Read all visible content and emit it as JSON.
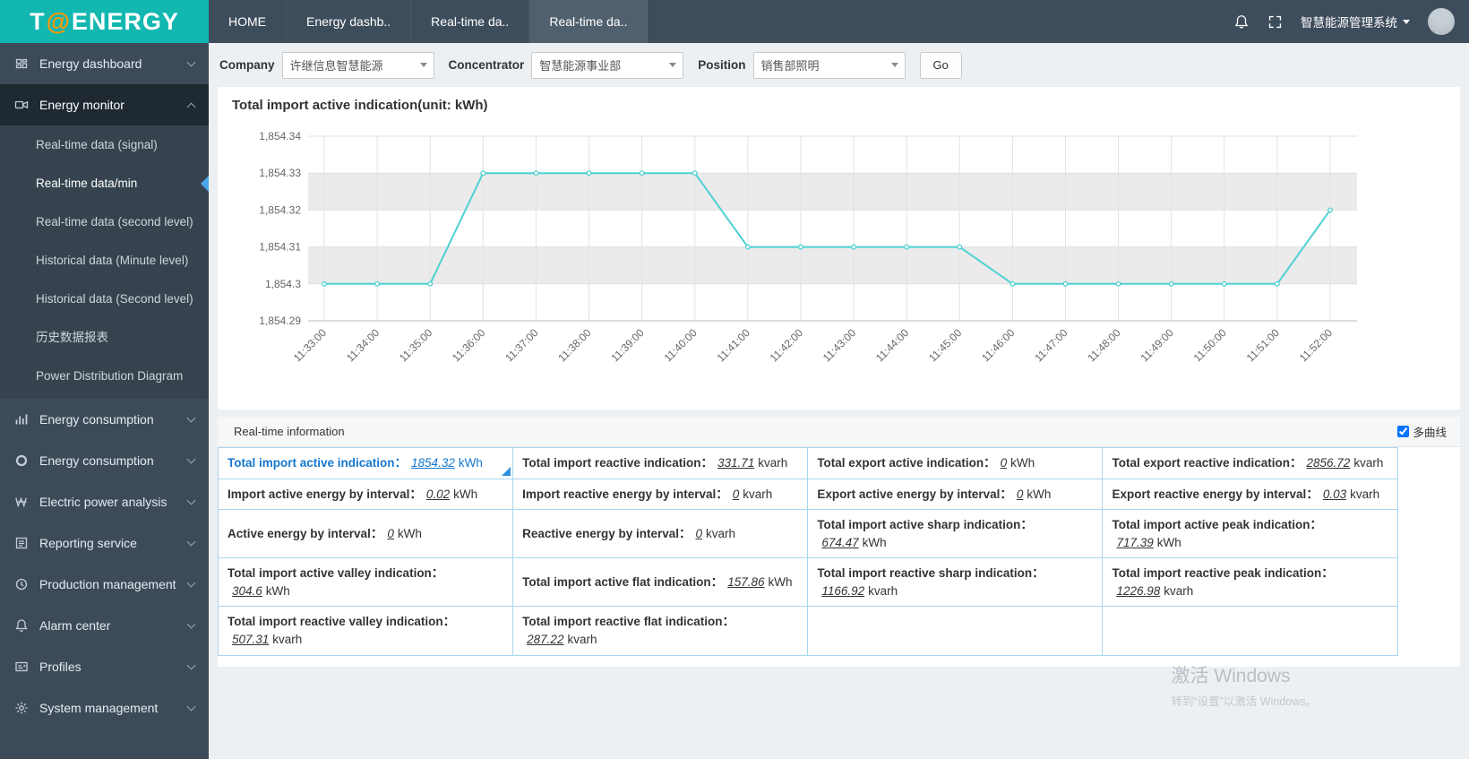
{
  "brand": {
    "part1": "T",
    "part2": "@",
    "part3": "ENERGY"
  },
  "topnav": {
    "tabs": [
      {
        "label": "HOME",
        "active": false
      },
      {
        "label": "Energy dashb..",
        "active": false
      },
      {
        "label": "Real-time da..",
        "active": false
      },
      {
        "label": "Real-time da..",
        "active": true
      }
    ],
    "system_menu": "智慧能源管理系统"
  },
  "sidebar": {
    "items": [
      {
        "label": "Energy dashboard",
        "icon": "dashboard-icon"
      },
      {
        "label": "Energy monitor",
        "icon": "monitor-icon",
        "active": true,
        "expanded": true,
        "children": [
          {
            "label": "Real-time data (signal)"
          },
          {
            "label": "Real-time data/min",
            "active": true
          },
          {
            "label": "Real-time data (second level)"
          },
          {
            "label": "Historical data (Minute level)"
          },
          {
            "label": "Historical data (Second level)"
          },
          {
            "label": "历史数据报表"
          },
          {
            "label": "Power Distribution Diagram"
          }
        ]
      },
      {
        "label": "Energy consumption",
        "icon": "bar-chart-icon"
      },
      {
        "label": "Energy consumption",
        "icon": "donut-icon"
      },
      {
        "label": "Electric power analysis",
        "icon": "power-icon"
      },
      {
        "label": "Reporting service",
        "icon": "report-icon"
      },
      {
        "label": "Production management",
        "icon": "clock-icon"
      },
      {
        "label": "Alarm center",
        "icon": "alarm-bell-icon"
      },
      {
        "label": "Profiles",
        "icon": "profiles-card-icon"
      },
      {
        "label": "System management",
        "icon": "gear-icon"
      }
    ]
  },
  "filters": {
    "company_label": "Company",
    "company_value": "许继信息智慧能源",
    "concentrator_label": "Concentrator",
    "concentrator_value": "智慧能源事业部",
    "position_label": "Position",
    "position_value": "销售部照明",
    "go_label": "Go"
  },
  "chart_data": {
    "type": "line",
    "title": "Total import active indication(unit:  kWh)",
    "x": [
      "11:33:00",
      "11:34:00",
      "11:35:00",
      "11:36:00",
      "11:37:00",
      "11:38:00",
      "11:39:00",
      "11:40:00",
      "11:41:00",
      "11:42:00",
      "11:43:00",
      "11:44:00",
      "11:45:00",
      "11:46:00",
      "11:47:00",
      "11:48:00",
      "11:49:00",
      "11:50:00",
      "11:51:00",
      "11:52:00"
    ],
    "values": [
      1854.3,
      1854.3,
      1854.3,
      1854.33,
      1854.33,
      1854.33,
      1854.33,
      1854.33,
      1854.31,
      1854.31,
      1854.31,
      1854.31,
      1854.31,
      1854.3,
      1854.3,
      1854.3,
      1854.3,
      1854.3,
      1854.3,
      1854.32
    ],
    "ylim": [
      1854.29,
      1854.34
    ],
    "ytick_labels": [
      "1,854.29",
      "1,854.3",
      "1,854.31",
      "1,854.32",
      "1,854.33",
      "1,854.34"
    ],
    "xlabel": "",
    "ylabel": "",
    "grid": true,
    "legend_position": "none",
    "line_color": "#4ed0d2"
  },
  "info_panel": {
    "title": "Real-time information",
    "multi_curve_label": "多曲线",
    "multi_curve_checked": true,
    "rows": [
      [
        {
          "label": "Total import active indication：",
          "value": "1854.32",
          "unit": "kWh",
          "highlight": true
        },
        {
          "label": "Total import reactive indication：",
          "value": "331.71",
          "unit": "kvarh"
        },
        {
          "label": "Total export active indication：",
          "value": "0",
          "unit": "kWh"
        },
        {
          "label": "Total export reactive indication：",
          "value": "2856.72",
          "unit": "kvarh"
        }
      ],
      [
        {
          "label": "Import active energy by interval：",
          "value": "0.02",
          "unit": "kWh"
        },
        {
          "label": "Import reactive energy by interval：",
          "value": "0",
          "unit": "kvarh"
        },
        {
          "label": "Export active energy by interval：",
          "value": "0",
          "unit": "kWh"
        },
        {
          "label": "Export reactive energy by interval：",
          "value": "0.03",
          "unit": "kvarh"
        }
      ],
      [
        {
          "label": "Active energy by interval：",
          "value": "0",
          "unit": "kWh"
        },
        {
          "label": "Reactive energy by interval：",
          "value": "0",
          "unit": "kvarh"
        },
        {
          "label": "Total import active sharp indication：",
          "value": "674.47",
          "unit": "kWh"
        },
        {
          "label": "Total import active peak indication：",
          "value": "717.39",
          "unit": "kWh"
        }
      ],
      [
        {
          "label": "Total import active valley indication：",
          "value": "304.6",
          "unit": "kWh"
        },
        {
          "label": "Total import active flat indication：",
          "value": "157.86",
          "unit": "kWh"
        },
        {
          "label": "Total import reactive sharp indication：",
          "value": "1166.92",
          "unit": "kvarh"
        },
        {
          "label": "Total import reactive peak indication：",
          "value": "1226.98",
          "unit": "kvarh"
        }
      ],
      [
        {
          "label": "Total import reactive valley indication：",
          "value": "507.31",
          "unit": "kvarh"
        },
        {
          "label": "Total import reactive flat indication：",
          "value": "287.22",
          "unit": "kvarh"
        },
        null,
        null
      ]
    ]
  },
  "watermark": {
    "line1": "激活 Windows",
    "line2": "转到“设置”以激活 Windows。"
  },
  "colors": {
    "accent_teal": "#12b7b0",
    "accent_orange": "#ff9800",
    "link_blue": "#1678cf",
    "table_border": "#a9d6f2",
    "chart_line": "#4ed0d2"
  }
}
